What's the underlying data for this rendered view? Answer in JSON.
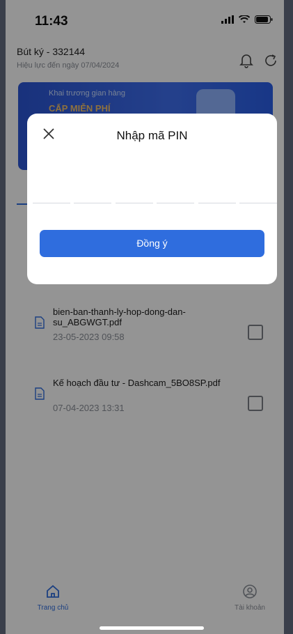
{
  "status_bar": {
    "time": "11:43"
  },
  "header": {
    "title": "Bút ký - 332144",
    "subtitle": "Hiệu lực đến ngày 07/04/2024"
  },
  "banner": {
    "line1": "Khai trương gian hàng",
    "line2": "CẤP MIỄN PHÍ"
  },
  "documents": [
    {
      "name": "bien-ban-thanh-ly-hop-dong-dan-su_ABGWGT.pdf",
      "date": "23-05-2023 09:58"
    },
    {
      "name": "Kế hoạch đầu tư - Dashcam_5BO8SP.pdf",
      "date": "07-04-2023 13:31"
    }
  ],
  "bottom_nav": {
    "home_label": "Trang chủ",
    "account_label": "Tài khoản"
  },
  "modal": {
    "title": "Nhập mã PIN",
    "confirm_label": "Đồng ý",
    "pin_digits": 6
  },
  "colors": {
    "primary": "#2f6dde",
    "overlay": "rgba(0,0,0,0.42)"
  }
}
